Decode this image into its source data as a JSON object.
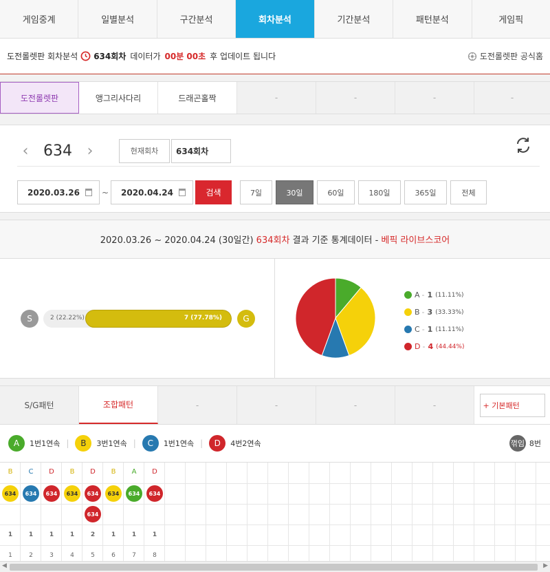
{
  "nav": {
    "tabs": [
      "게임중계",
      "일별분석",
      "구간분석",
      "회차분석",
      "기간분석",
      "패턴분석",
      "게임픽"
    ],
    "active": 3
  },
  "notice": {
    "game": "도전롤렛판 회차분석",
    "round": "634회차",
    "text1": "데이터가",
    "remain": "00분 00초",
    "text2": "후 업데이트 됩니다",
    "home_link": "도전롤렛판 공식홈"
  },
  "game_tabs": {
    "items": [
      "도전롤렛판",
      "앵그리사다리",
      "드래곤홀짝",
      "-",
      "-",
      "-",
      "-"
    ],
    "active": 0
  },
  "round": {
    "prev_icon": "chevron-left-icon",
    "number": "634",
    "next_icon": "chevron-right-icon",
    "current_label": "현재회차",
    "round_value": "634회차"
  },
  "search": {
    "start_date": "2020.03.26",
    "end_date": "2020.04.24",
    "tilde": "~",
    "search_label": "검색",
    "periods": [
      "7일",
      "30일",
      "60일",
      "180일",
      "365일",
      "전체"
    ],
    "active_period": 1
  },
  "stats": {
    "range": "2020.03.26 ~ 2020.04.24 (30일간)",
    "round": "634회차",
    "text": "결과 기준 통계데이터 -",
    "source": "베픽 라이브스코어",
    "s_label": "S",
    "g_label": "G",
    "s_text": "2 (22.22%)",
    "g_text": "7 (77.78%)",
    "g_fraction": 0.7778,
    "legend": [
      {
        "name": "A",
        "count": "1",
        "pct": "(11.11%)",
        "color": "#4aab2b"
      },
      {
        "name": "B",
        "count": "3",
        "pct": "(33.33%)",
        "color": "#f5d10a"
      },
      {
        "name": "C",
        "count": "1",
        "pct": "(11.11%)",
        "color": "#2779b0"
      },
      {
        "name": "D",
        "count": "4",
        "pct": "(44.44%)",
        "color": "#d0262b"
      }
    ]
  },
  "pattern_tabs": {
    "items": [
      "S/G패턴",
      "조합패턴",
      "-",
      "-",
      "-",
      "-"
    ],
    "active": 1,
    "basic": "+ 기본패턴"
  },
  "summary": {
    "items": [
      {
        "letter": "A",
        "text": "1번1연속",
        "color": "#4aab2b"
      },
      {
        "letter": "B",
        "text": "3번1연속",
        "color": "#f5d10a"
      },
      {
        "letter": "C",
        "text": "1번1연속",
        "color": "#2779b0"
      },
      {
        "letter": "D",
        "text": "4번2연속",
        "color": "#d0262b"
      }
    ],
    "flip_label": "꺾임",
    "flip_count": "8번"
  },
  "pattern": {
    "columns": [
      {
        "head": "B",
        "balls": [
          "634"
        ],
        "count": "1",
        "index": "1"
      },
      {
        "head": "C",
        "balls": [
          "634"
        ],
        "count": "1",
        "index": "2"
      },
      {
        "head": "D",
        "balls": [
          "634"
        ],
        "count": "1",
        "index": "3"
      },
      {
        "head": "B",
        "balls": [
          "634"
        ],
        "count": "1",
        "index": "4"
      },
      {
        "head": "D",
        "balls": [
          "634",
          "634"
        ],
        "count": "2",
        "index": "5"
      },
      {
        "head": "B",
        "balls": [
          "634"
        ],
        "count": "1",
        "index": "6"
      },
      {
        "head": "A",
        "balls": [
          "634"
        ],
        "count": "1",
        "index": "7"
      },
      {
        "head": "D",
        "balls": [
          "634"
        ],
        "count": "1",
        "index": "8"
      }
    ],
    "colors": {
      "A": "#4aab2b",
      "B": "#f5d10a",
      "C": "#2779b0",
      "D": "#d0262b"
    },
    "head_colors": {
      "A": "#4aab2b",
      "B": "#d4b30a",
      "C": "#2779b0",
      "D": "#d0262b"
    }
  }
}
